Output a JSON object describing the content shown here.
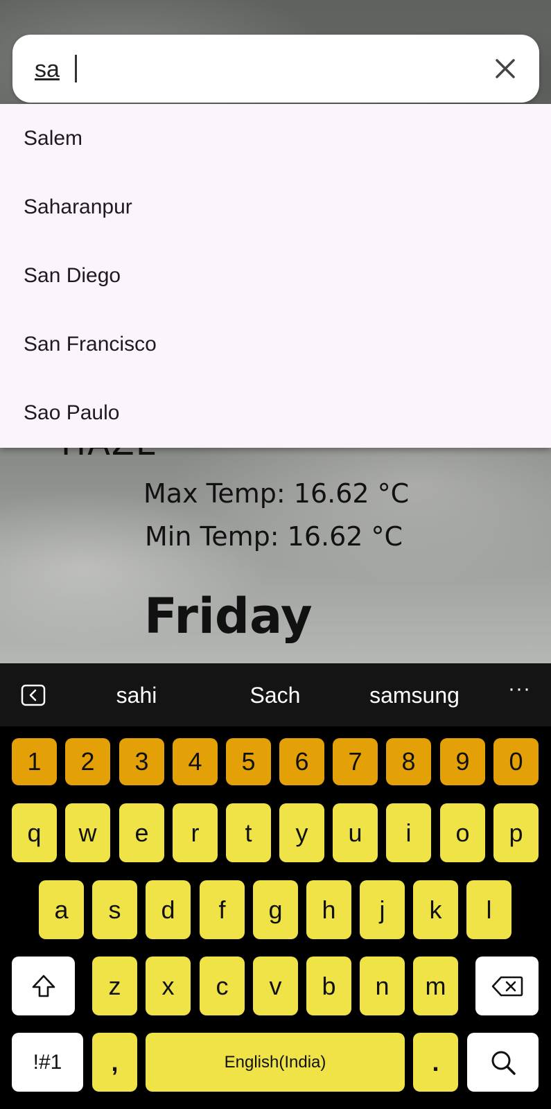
{
  "weather": {
    "condition": "HAZE",
    "max_temp": "Max Temp: 16.62 °C",
    "min_temp": "Min Temp: 16.62 °C",
    "day": "Friday"
  },
  "search": {
    "value": "sa",
    "clear_icon": "close-icon"
  },
  "suggestions": [
    "Salem",
    "Saharanpur",
    "San Diego",
    "San Francisco",
    "Sao Paulo"
  ],
  "keyboard": {
    "suggestions": [
      "sahi",
      "Sach",
      "samsung"
    ],
    "more": "···",
    "number_row": [
      "1",
      "2",
      "3",
      "4",
      "5",
      "6",
      "7",
      "8",
      "9",
      "0"
    ],
    "row1": [
      "q",
      "w",
      "e",
      "r",
      "t",
      "y",
      "u",
      "i",
      "o",
      "p"
    ],
    "row2": [
      "a",
      "s",
      "d",
      "f",
      "g",
      "h",
      "j",
      "k",
      "l"
    ],
    "row3": [
      "z",
      "x",
      "c",
      "v",
      "b",
      "n",
      "m"
    ],
    "symbols_label": "!#1",
    "comma": ",",
    "space_label": "English(India)",
    "period": ".",
    "colors": {
      "number_keys": "#e3a107",
      "letter_keys": "#efe347",
      "background": "#000000"
    }
  }
}
